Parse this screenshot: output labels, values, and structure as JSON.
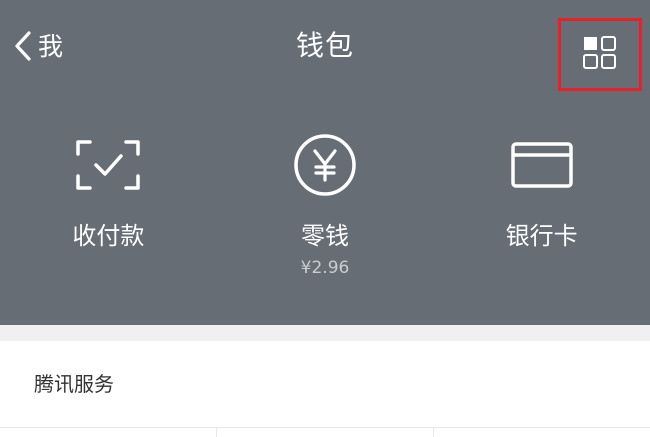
{
  "nav": {
    "back_label": "我",
    "title": "钱包"
  },
  "actions": [
    {
      "label": "收付款",
      "sub": ""
    },
    {
      "label": "零钱",
      "sub": "¥2.96"
    },
    {
      "label": "银行卡",
      "sub": ""
    }
  ],
  "services": {
    "title": "腾讯服务"
  },
  "colors": {
    "header_bg": "#666d75",
    "highlight_border": "#e8202a",
    "icon_color": "#ffffff"
  },
  "icons": {
    "back": "chevron-left-icon",
    "menu": "grid-menu-icon",
    "pay": "scan-check-icon",
    "change": "yen-coin-icon",
    "card": "bank-card-icon"
  }
}
